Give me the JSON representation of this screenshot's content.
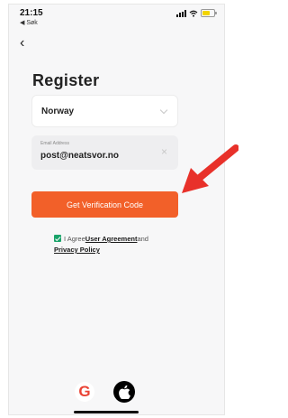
{
  "status_bar": {
    "time": "21:15",
    "back_app": "◀ Søk"
  },
  "nav": {
    "back_icon": "‹"
  },
  "page": {
    "title": "Register"
  },
  "country": {
    "value": "Norway"
  },
  "email": {
    "label": "Email Address",
    "value": "post@neatsvor.no",
    "clear_icon": "×"
  },
  "primary_button": {
    "label": "Get Verification Code"
  },
  "agreement": {
    "prefix": "I Agree",
    "user_agreement": "User Agreement",
    "and": "and",
    "privacy_policy": "Privacy Policy",
    "checked": true
  },
  "social": {
    "google_letter": "G",
    "apple_icon": "apple-logo-icon"
  },
  "colors": {
    "accent": "#f26029",
    "arrow": "#e8312a",
    "checkbox": "#1aa36a"
  }
}
